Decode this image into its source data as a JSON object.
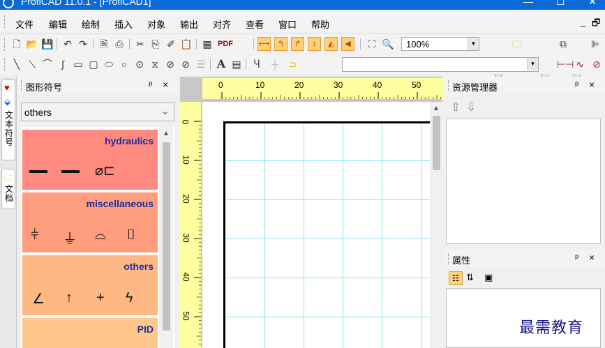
{
  "window": {
    "title": "ProfiCAD 11.0.1 - [ProfiCAD1]",
    "minimize_label": "—",
    "maximize_label": "☐",
    "close_label": "✕"
  },
  "menubar": {
    "items": [
      "文件",
      "编辑",
      "绘制",
      "插入",
      "对象",
      "输出",
      "对齐",
      "查看",
      "窗口",
      "帮助"
    ],
    "mdi_minimize": "_",
    "mdi_restore": "🗗"
  },
  "toolbar": {
    "pdf_label": "PDF",
    "zoom_value": "100%",
    "text_tool_label": "A"
  },
  "side_tabs": [
    "文本符号",
    "文档"
  ],
  "symbols_panel": {
    "title": "图形符号",
    "pin": "ᵖ",
    "close": "×",
    "category_selected": "others",
    "libraries": [
      {
        "name": "hydraulics",
        "color": "#ff8a80",
        "glyphs": [
          "▬▬",
          "▬▬",
          "⌀⊏"
        ]
      },
      {
        "name": "miscellaneous",
        "color": "#ff9e7e",
        "glyphs": [
          "⫩",
          "⏚",
          "⌓",
          "⌷"
        ]
      },
      {
        "name": "others",
        "color": "#ffb784",
        "glyphs": [
          "∠",
          "↑",
          "+",
          "ϟ"
        ]
      },
      {
        "name": "PID",
        "color": "#ffc88a",
        "glyphs": []
      }
    ]
  },
  "canvas": {
    "ruler_h": [
      "0",
      "10",
      "20",
      "30",
      "40",
      "50"
    ],
    "ruler_v": [
      "0",
      "10",
      "20",
      "30",
      "40",
      "50"
    ]
  },
  "resource_panel": {
    "title": "资源管理器",
    "pin": "ᵖ",
    "close": "×"
  },
  "properties_panel": {
    "title": "属性",
    "pin": "ᵖ",
    "close": "×"
  },
  "watermark": "最需教育",
  "colors": {
    "titlebar": "#0a6ad6",
    "grid": "#8ee4ef",
    "ruler": "#ffffa0",
    "library_title": "#1a2fa0"
  }
}
